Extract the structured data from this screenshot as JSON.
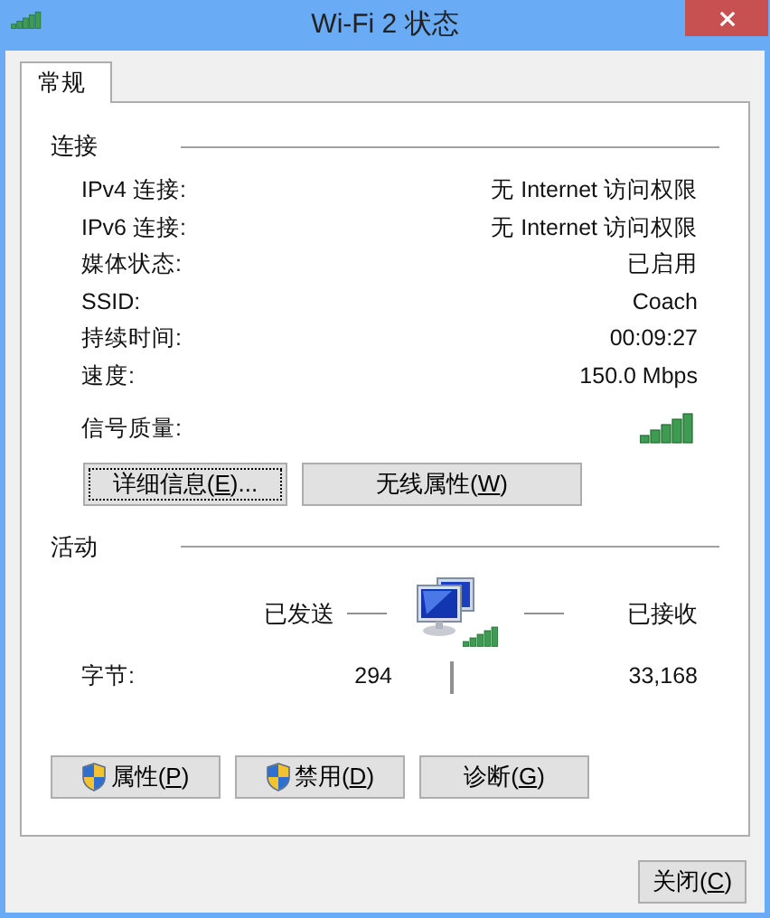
{
  "window": {
    "title": "Wi-Fi 2 状态"
  },
  "tabs": [
    {
      "label": "常规",
      "selected": true
    }
  ],
  "connection": {
    "heading": "连接",
    "rows": [
      {
        "label": "IPv4 连接:",
        "value": "无 Internet 访问权限"
      },
      {
        "label": "IPv6 连接:",
        "value": "无 Internet 访问权限"
      },
      {
        "label": "媒体状态:",
        "value": "已启用"
      },
      {
        "label": "SSID:",
        "value": "Coach"
      },
      {
        "label": "持续时间:",
        "value": "00:09:27"
      },
      {
        "label": "速度:",
        "value": "150.0 Mbps"
      }
    ],
    "signal_label": "信号质量:",
    "buttons": [
      {
        "before": "详细信息(",
        "key": "E",
        "after": ")...",
        "focused": true,
        "shield": false
      },
      {
        "before": "无线属性(",
        "key": "W",
        "after": ")",
        "focused": false,
        "shield": false
      }
    ]
  },
  "activity": {
    "heading": "活动",
    "sent_label": "已发送",
    "received_label": "已接收",
    "bytes_label": "字节:",
    "bytes_sent": "294",
    "bytes_received": "33,168",
    "buttons": [
      {
        "before": "属性(",
        "key": "P",
        "after": ")",
        "focused": false,
        "shield": true
      },
      {
        "before": "禁用(",
        "key": "D",
        "after": ")",
        "focused": false,
        "shield": true
      },
      {
        "before": "诊断(",
        "key": "G",
        "after": ")",
        "focused": false,
        "shield": false
      }
    ]
  },
  "close_button": {
    "before": "关闭(",
    "key": "C",
    "after": ")",
    "focused": false,
    "shield": false
  }
}
